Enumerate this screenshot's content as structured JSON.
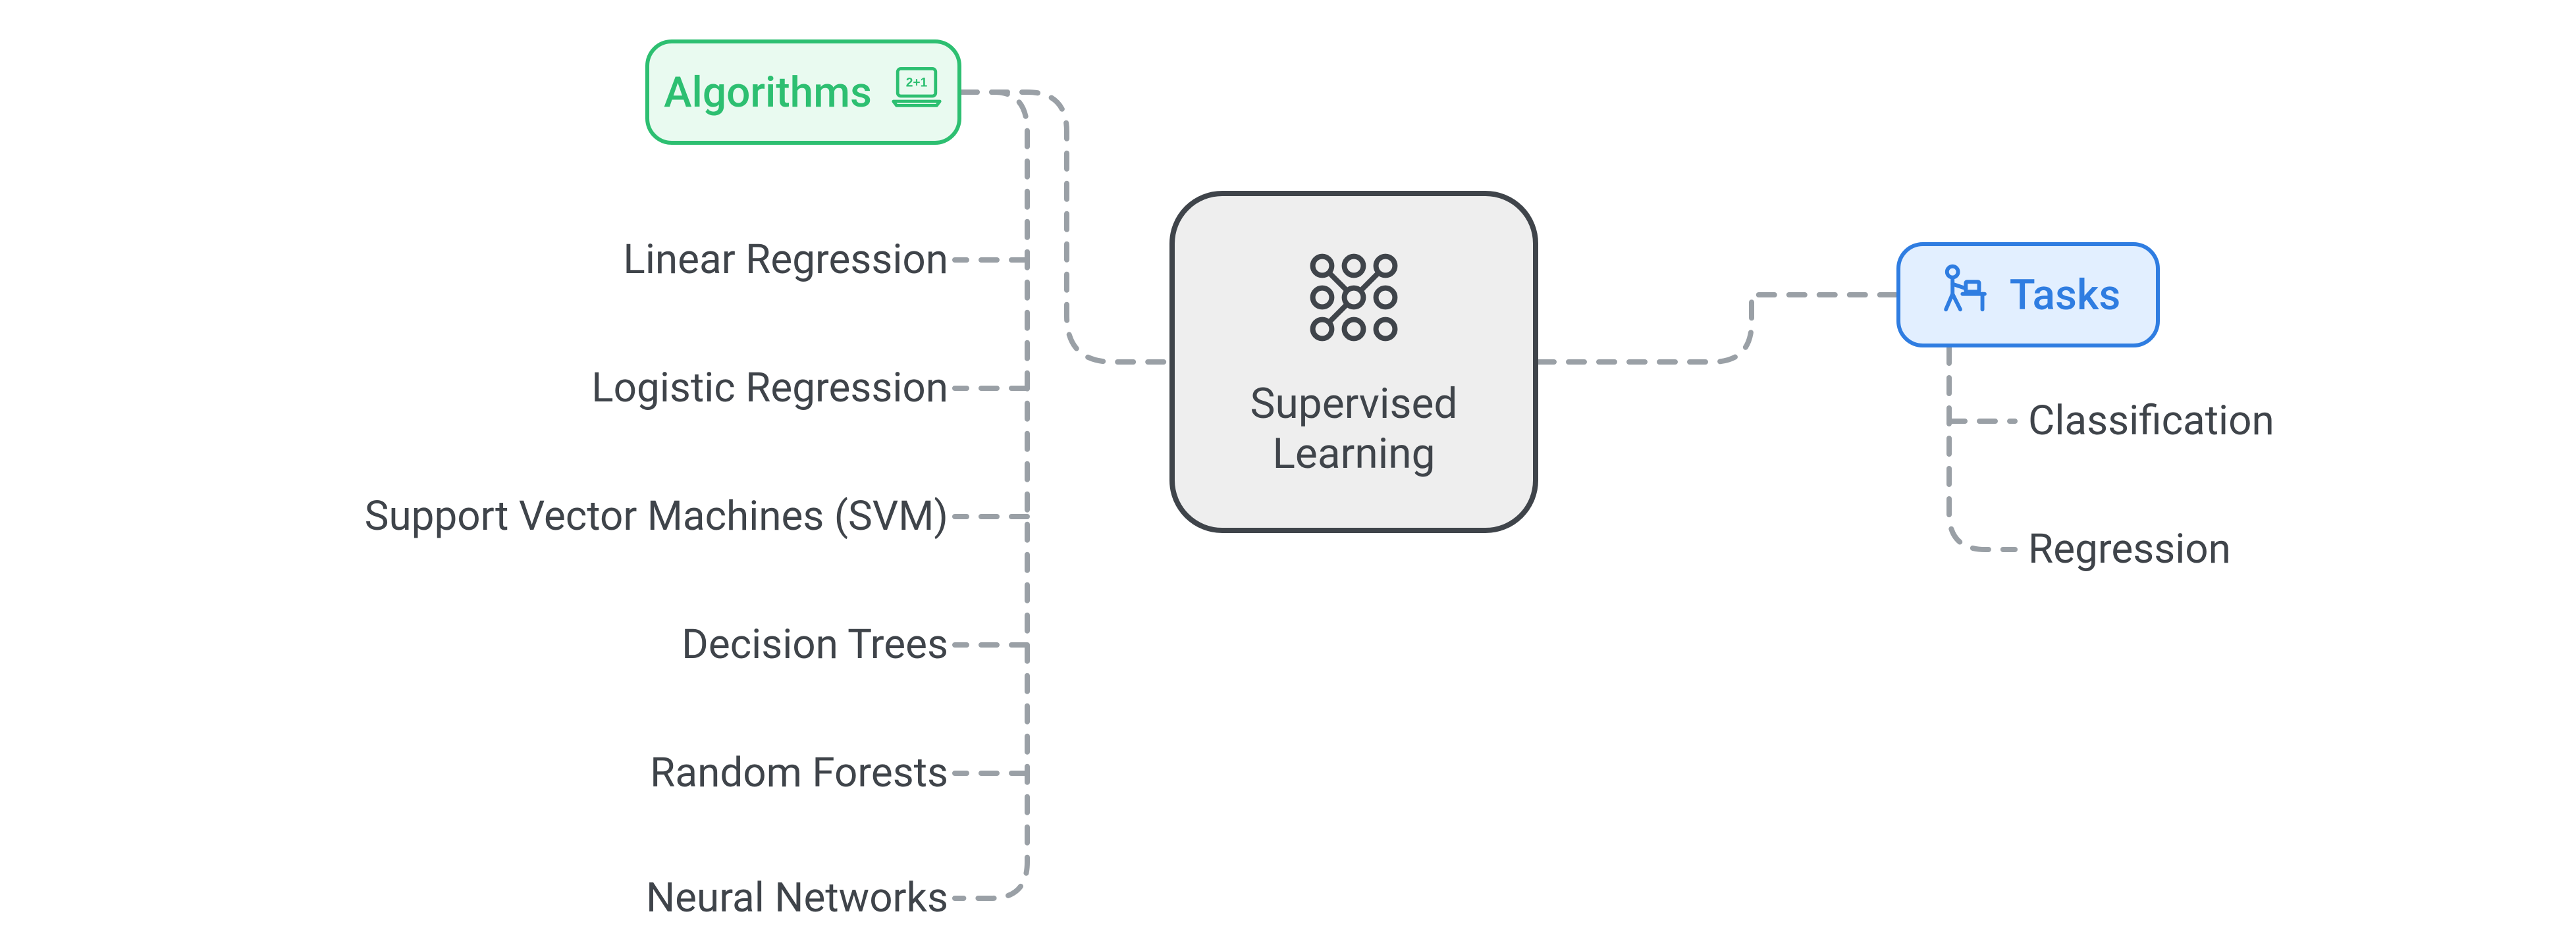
{
  "diagram": {
    "center": {
      "label": "Supervised\nLearning"
    },
    "algorithms": {
      "title": "Algorithms",
      "items": [
        "Linear Regression",
        "Logistic Regression",
        "Support Vector Machines (SVM)",
        "Decision Trees",
        "Random Forests",
        "Neural Networks"
      ]
    },
    "tasks": {
      "title": "Tasks",
      "items": [
        "Classification",
        "Regression"
      ]
    },
    "colors": {
      "center_border": "#3f444a",
      "center_bg": "#eeeeee",
      "algorithms_border": "#2dbf71",
      "algorithms_bg": "#e9faf0",
      "tasks_border": "#2f7de1",
      "tasks_bg": "#e2efff",
      "connector": "#9aa0a6",
      "text": "#3f444a"
    }
  }
}
